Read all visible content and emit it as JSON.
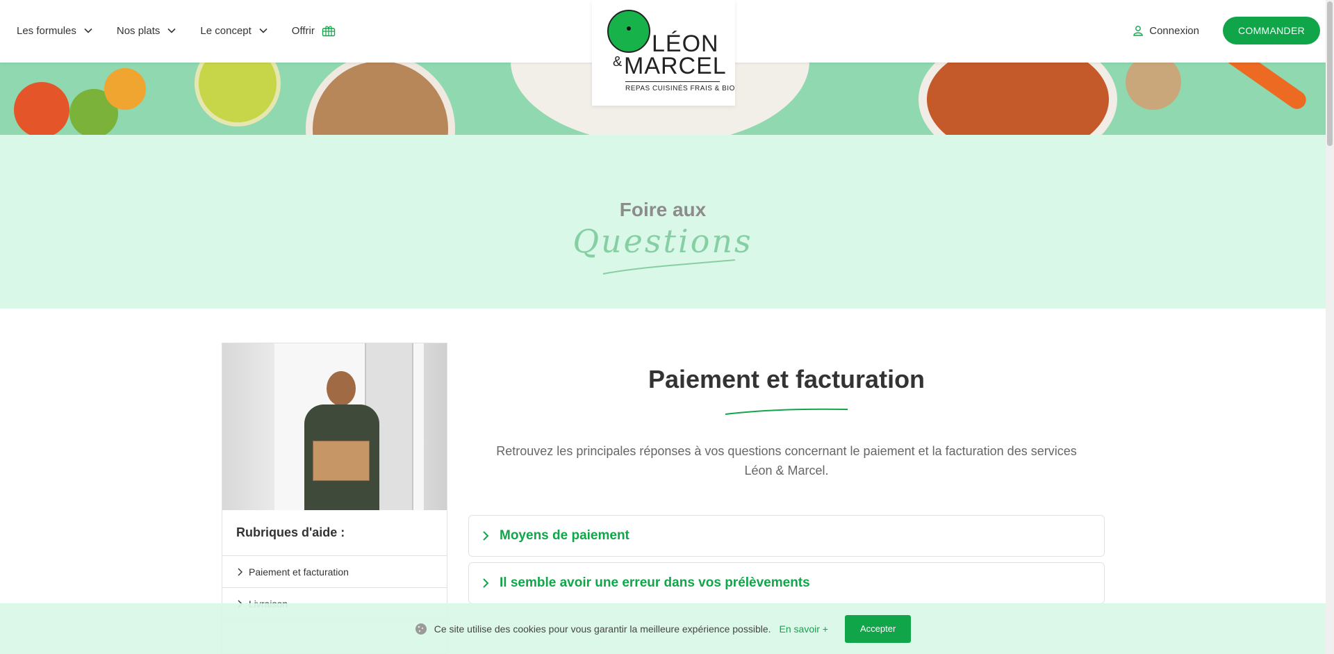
{
  "header": {
    "nav": [
      {
        "label": "Les formules"
      },
      {
        "label": "Nos plats"
      },
      {
        "label": "Le concept"
      },
      {
        "label": "Offrir"
      }
    ],
    "login_label": "Connexion",
    "order_label": "COMMANDER"
  },
  "logo": {
    "line1": "LÉON",
    "amp": "&",
    "line2": "MARCEL",
    "tagline": "REPAS CUISINÉS FRAIS & BIO"
  },
  "hero": {
    "line1": "Foire aux",
    "line2": "Questions"
  },
  "sidebar": {
    "title": "Rubriques d'aide :",
    "links": [
      {
        "label": "Paiement et facturation"
      },
      {
        "label": "Livraison"
      }
    ]
  },
  "main": {
    "title": "Paiement et facturation",
    "intro": "Retrouvez les principales réponses à vos questions concernant le paiement et la facturation des services Léon & Marcel.",
    "faq": [
      {
        "label": "Moyens de paiement"
      },
      {
        "label": "Il semble avoir une erreur dans vos prélèvements"
      }
    ]
  },
  "cookie": {
    "text": "Ce site utilise des cookies pour vous garantir la meilleure expérience possible.",
    "more": "En savoir +",
    "accept": "Accepter"
  },
  "colors": {
    "brand_green": "#11a54a",
    "hero_bg": "#d9f8e7",
    "banner_bg": "#8fd8b0"
  }
}
